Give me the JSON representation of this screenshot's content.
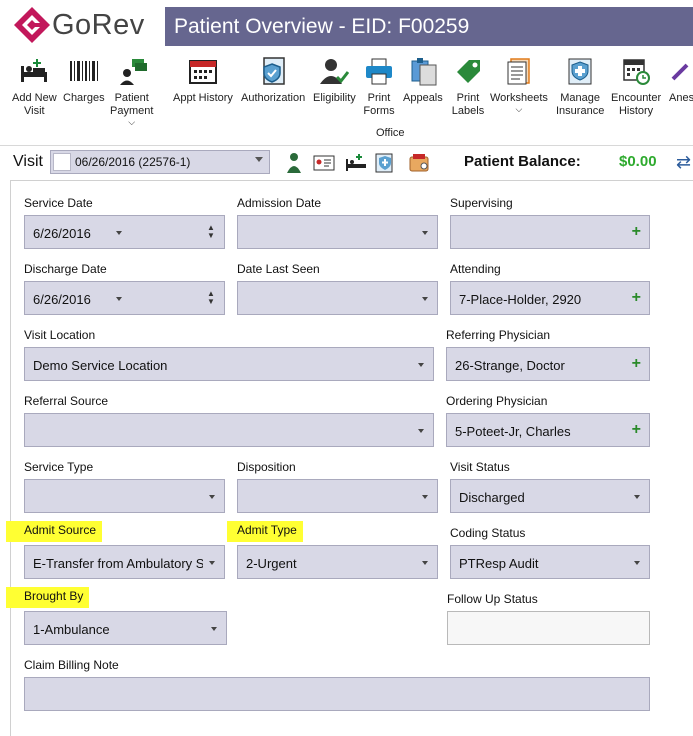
{
  "brand": {
    "name": "GoRev"
  },
  "window": {
    "title": "Patient Overview - EID: F00259"
  },
  "toolbar": {
    "buttons": [
      {
        "label": "Add New\nVisit",
        "icon": "add-visit-icon"
      },
      {
        "label": "Charges",
        "icon": "barcode-icon"
      },
      {
        "label": "Patient\nPayment",
        "icon": "payment-icon",
        "dropdown": true
      },
      {
        "label": "Appt History",
        "icon": "calendar-icon"
      },
      {
        "label": "Authorization",
        "icon": "shield-check-icon"
      },
      {
        "label": "Eligibility",
        "icon": "user-check-icon"
      },
      {
        "label": "Print\nForms",
        "icon": "printer-icon"
      },
      {
        "label": "Appeals",
        "icon": "appeals-icon"
      },
      {
        "label": "Print\nLabels",
        "icon": "tag-icon"
      },
      {
        "label": "Worksheets",
        "icon": "worksheet-icon",
        "dropdown": true
      },
      {
        "label": "Manage\nInsurance",
        "icon": "insurance-icon"
      },
      {
        "label": "Encounter\nHistory",
        "icon": "encounter-history-icon"
      },
      {
        "label": "Anes",
        "icon": "anesthesia-icon"
      }
    ],
    "group_label": "Office"
  },
  "visit": {
    "label": "Visit",
    "selected": "06/26/2016 (22576-1)"
  },
  "balance": {
    "label": "Patient Balance:",
    "value": "$0.00"
  },
  "form": {
    "service_date": {
      "label": "Service Date",
      "value": "6/26/2016"
    },
    "admission_date": {
      "label": "Admission Date",
      "value": ""
    },
    "supervising": {
      "label": "Supervising",
      "value": ""
    },
    "discharge_date": {
      "label": "Discharge Date",
      "value": "6/26/2016"
    },
    "date_last_seen": {
      "label": "Date Last Seen",
      "value": ""
    },
    "attending": {
      "label": "Attending",
      "value": "7-Place-Holder, 2920"
    },
    "visit_location": {
      "label": "Visit Location",
      "value": "Demo Service Location"
    },
    "referring_physician": {
      "label": "Referring Physician",
      "value": "26-Strange, Doctor"
    },
    "referral_source": {
      "label": "Referral Source",
      "value": ""
    },
    "ordering_physician": {
      "label": "Ordering Physician",
      "value": "5-Poteet-Jr, Charles"
    },
    "service_type": {
      "label": "Service Type",
      "value": ""
    },
    "disposition": {
      "label": "Disposition",
      "value": ""
    },
    "visit_status": {
      "label": "Visit Status",
      "value": "Discharged"
    },
    "admit_source": {
      "label": "Admit Source",
      "value": "E-Transfer from Ambulatory Surgery Center"
    },
    "admit_type": {
      "label": "Admit Type",
      "value": "2-Urgent"
    },
    "coding_status": {
      "label": "Coding Status",
      "value": "PTResp Audit"
    },
    "brought_by": {
      "label": "Brought By",
      "value": "1-Ambulance"
    },
    "follow_up_status": {
      "label": "Follow Up Status",
      "value": ""
    },
    "claim_billing_note": {
      "label": "Claim Billing Note",
      "value": ""
    }
  },
  "colors": {
    "title_bar": "#66668f",
    "field_bg": "#d8d8e6",
    "highlight": "#ffff33",
    "balance_green": "#2eaa2e",
    "brand_magenta": "#c2185b"
  }
}
